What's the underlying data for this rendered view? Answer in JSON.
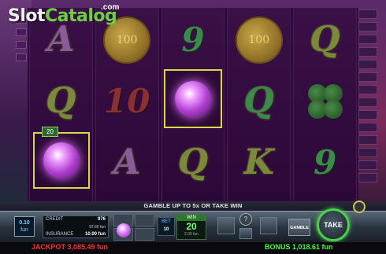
{
  "logo": {
    "brand": "SlotCatalog",
    "brand_part1": "Slot",
    "brand_part2": "Catalog",
    "suffix": ".com"
  },
  "win_badge": "20",
  "reels": [
    [
      "A",
      "Q",
      "crystal-ball"
    ],
    [
      "coin",
      "10",
      "A"
    ],
    [
      "9",
      "crystal-ball",
      "Q"
    ],
    [
      "coin",
      "Q",
      "K"
    ],
    [
      "Q",
      "clover",
      "9"
    ]
  ],
  "message": "GAMBLE UP TO 5x OR TAKE WIN",
  "bet_selector": {
    "value": "0.10",
    "unit": "fun",
    "sub": "TAB"
  },
  "info_panel": {
    "credit_label": "CREDIT",
    "credit_value": "976",
    "credit_sub": "97.60 fun",
    "insurance_label": "INSURANCE",
    "insurance_value": "10.00 fun"
  },
  "bet": {
    "label": "BET",
    "value": "10"
  },
  "win": {
    "label": "WIN",
    "value": "20",
    "sub": "2.00 fun"
  },
  "buttons": {
    "gamble": "GAMBLE",
    "take": "TAKE",
    "help": "?"
  },
  "jackpot": "JACKPOT 3,085.49 fun",
  "bonus": "BONUS 1,018.61 fun",
  "colors": {
    "accent_green": "#4ad04a",
    "jackpot_red": "#ff3030",
    "bonus_green": "#40ff40"
  }
}
